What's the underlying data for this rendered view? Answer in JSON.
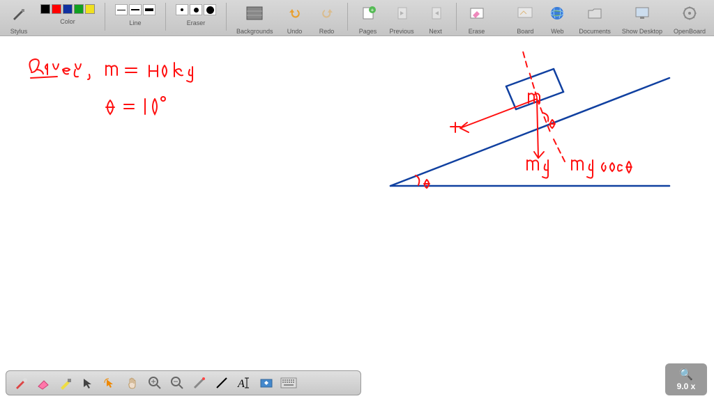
{
  "toolbar": {
    "stylus_label": "Stylus",
    "color_label": "Color",
    "line_label": "Line",
    "eraser_label": "Eraser",
    "backgrounds_label": "Backgrounds",
    "undo_label": "Undo",
    "redo_label": "Redo",
    "pages_label": "Pages",
    "previous_label": "Previous",
    "next_label": "Next",
    "erase_label": "Erase",
    "board_label": "Board",
    "web_label": "Web",
    "documents_label": "Documents",
    "showdesktop_label": "Show Desktop",
    "openboard_label": "OpenBoard",
    "colors": [
      "#000000",
      "#ff0000",
      "#1030a0",
      "#10a020",
      "#f0e020"
    ]
  },
  "zoom": {
    "value": "9.0 x"
  },
  "handwriting": {
    "given": "Given ,",
    "m_eq": "m = 40 kg",
    "theta_eq": "θ = 10°",
    "m_on_block": "m",
    "theta_angle": "θ",
    "theta_at_block": "θ",
    "mg": "mg",
    "mgcos": "mg cosθ"
  }
}
